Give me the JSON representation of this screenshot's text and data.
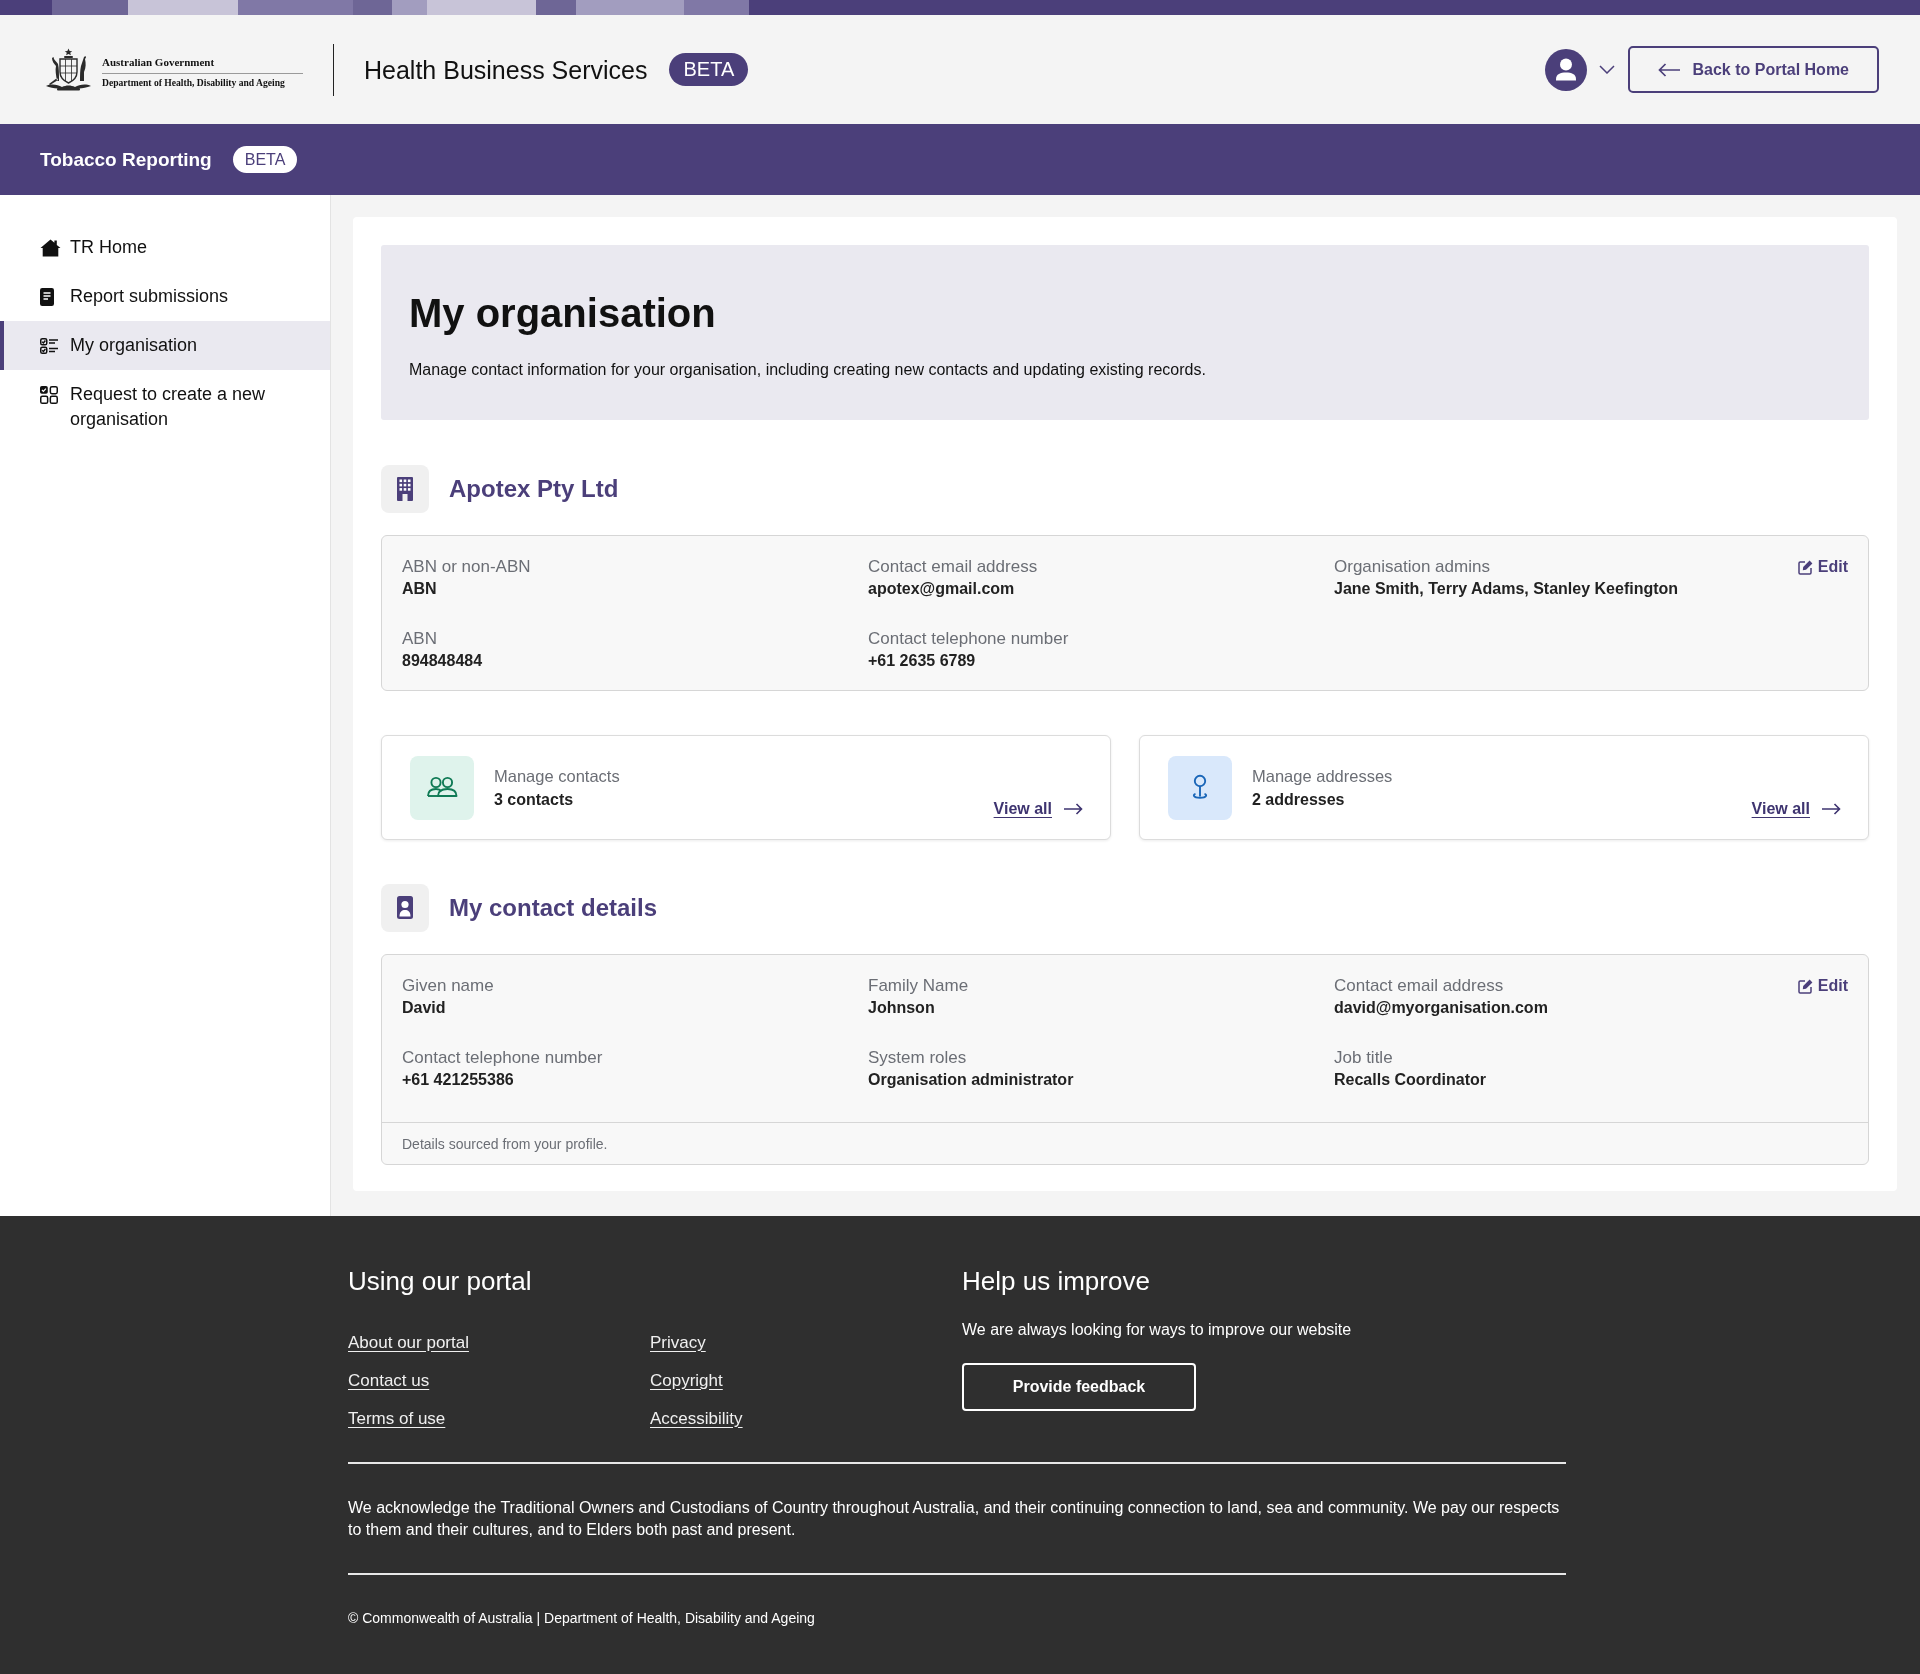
{
  "header": {
    "logo": {
      "line_1": "Australian Government",
      "line_2": "Department of Health, Disability and Ageing"
    },
    "title": "Health Business Services",
    "badge": "BETA",
    "back_button": "Back to Portal Home"
  },
  "app_bar": {
    "title": "Tobacco Reporting",
    "badge": "BETA"
  },
  "sidebar": {
    "items": [
      {
        "label": "TR Home",
        "selected": false
      },
      {
        "label": "Report submissions",
        "selected": false
      },
      {
        "label": "My organisation",
        "selected": true
      },
      {
        "label": "Request to create a new organisation",
        "selected": false
      }
    ]
  },
  "page": {
    "title": "My organisation",
    "description": "Manage contact information for your organisation, including creating new contacts and updating existing records."
  },
  "organisation": {
    "name": "Apotex Pty Ltd",
    "edit": "Edit",
    "fields": [
      {
        "label": "ABN or non-ABN",
        "value": "ABN"
      },
      {
        "label": "Contact email address",
        "value": "apotex@gmail.com"
      },
      {
        "label": "Organisation admins",
        "value": "Jane Smith, Terry Adams, Stanley Keefington"
      },
      {
        "label": "ABN",
        "value": "894848484"
      },
      {
        "label": "Contact telephone number",
        "value": "+61 2635 6789"
      }
    ]
  },
  "summary_cards": [
    {
      "kind": "contacts",
      "title": "Manage contacts",
      "count": "3 contacts",
      "link": "View all"
    },
    {
      "kind": "addresses",
      "title": "Manage addresses",
      "count": "2 addresses",
      "link": "View all"
    }
  ],
  "contact_details": {
    "title": "My contact details",
    "edit": "Edit",
    "fields": [
      {
        "label": "Given name",
        "value": "David"
      },
      {
        "label": "Family Name",
        "value": "Johnson"
      },
      {
        "label": "Contact email address",
        "value": "david@myorganisation.com"
      },
      {
        "label": "Contact telephone number",
        "value": "+61 421255386"
      },
      {
        "label": "System roles",
        "value": "Organisation administrator"
      },
      {
        "label": "Job title",
        "value": "Recalls Coordinator"
      }
    ],
    "note": "Details sourced from your profile."
  },
  "footer": {
    "portal": {
      "title": "Using our portal",
      "link_columns": [
        [
          "About our portal",
          "Contact us",
          "Terms of use"
        ],
        [
          "Privacy",
          "Copyright",
          "Accessibility"
        ]
      ]
    },
    "feedback": {
      "title": "Help us improve",
      "text": "We are always looking for ways to improve our website",
      "button": "Provide feedback"
    },
    "acknowledgement": "We acknowledge the Traditional Owners and Custodians of Country throughout Australia, and their continuing connection to land, sea and community. We pay our respects to them and their cultures, and to Elders both past and present.",
    "copyright": "© Commonwealth of Australia | Department of Health, Disability and Ageing"
  }
}
